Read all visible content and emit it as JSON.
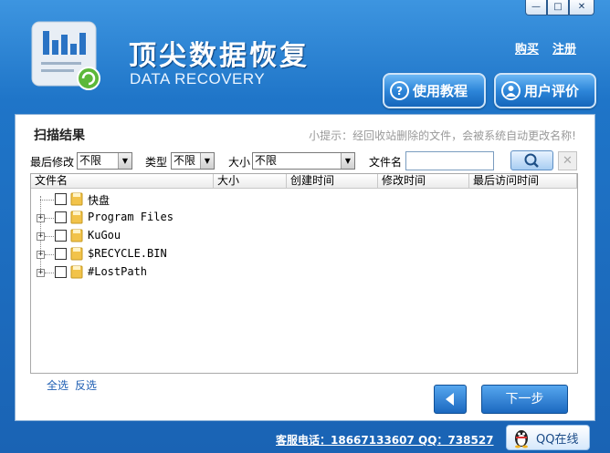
{
  "window": {
    "buttons": {
      "minimize": "—",
      "maximize": "□",
      "close": "✕"
    }
  },
  "header": {
    "brand_cn": "顶尖数据恢复",
    "brand_en": "DATA RECOVERY",
    "link_buy": "购买",
    "link_register": "注册",
    "btn_tutorial": "使用教程",
    "btn_review": "用户评价",
    "icons": {
      "tutorial": "question-icon",
      "review": "user-icon"
    }
  },
  "panel": {
    "title": "扫描结果",
    "tip": "小提示：经回收站删除的文件，会被系统自动更改名称!",
    "filters": {
      "last_modified_label": "最后修改",
      "last_modified_value": "不限",
      "type_label": "类型",
      "type_value": "不限",
      "size_label": "大小",
      "size_value": "不限",
      "filename_label": "文件名",
      "filename_value": ""
    },
    "columns": [
      "文件名",
      "大小",
      "创建时间",
      "修改时间",
      "最后访问时间"
    ],
    "rows": [
      {
        "name": "快盘",
        "expandable": false,
        "checked": false
      },
      {
        "name": "Program Files",
        "expandable": true,
        "checked": false
      },
      {
        "name": "KuGou",
        "expandable": true,
        "checked": false
      },
      {
        "name": "$RECYCLE.BIN",
        "expandable": true,
        "checked": false
      },
      {
        "name": "#LostPath",
        "expandable": true,
        "checked": false
      }
    ],
    "select_all": "全选",
    "invert_select": "反选",
    "btn_next": "下一步"
  },
  "footer": {
    "hotline": "客服电话：18667133607 QQ：738527",
    "qq_online": "QQ在线"
  },
  "colors": {
    "accent": "#1f75c8",
    "panel_bg": "#ffffff",
    "folder": "#f2c34a"
  }
}
